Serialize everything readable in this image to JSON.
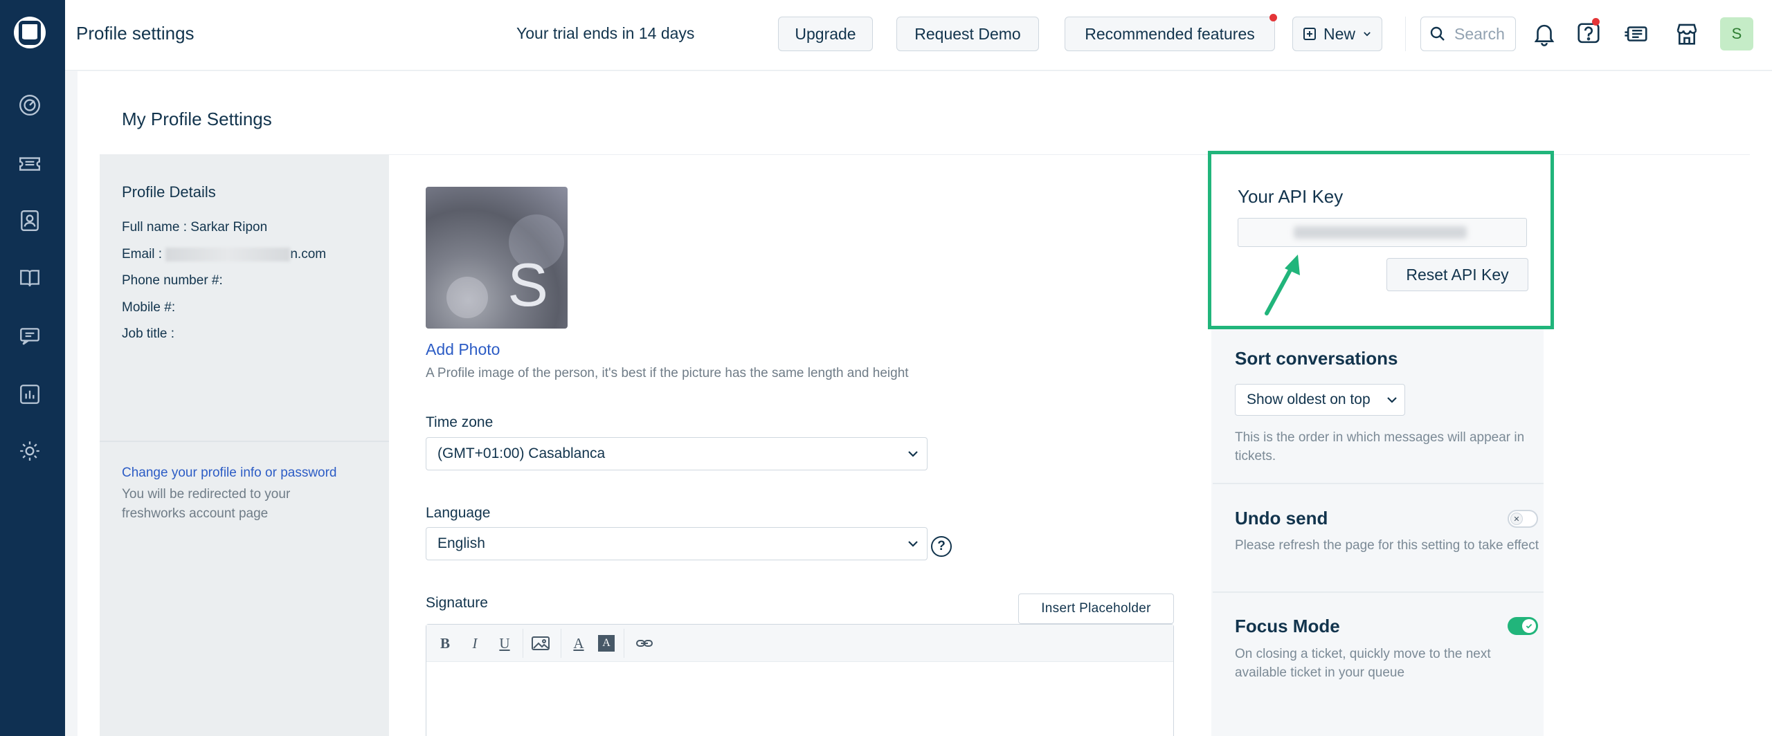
{
  "header": {
    "title": "Profile settings",
    "trial_text": "Your trial ends in 14 days",
    "upgrade_label": "Upgrade",
    "request_demo_label": "Request Demo",
    "recommended_label": "Recommended features",
    "new_label": "New",
    "search_placeholder": "Search",
    "avatar_initial": "S"
  },
  "sidebar": {
    "items": [
      "dashboard-icon",
      "tickets-icon",
      "contacts-icon",
      "solutions-icon",
      "forums-icon",
      "reports-icon",
      "admin-icon"
    ]
  },
  "main": {
    "section_title": "My Profile Settings"
  },
  "profile_details": {
    "title": "Profile Details",
    "full_name_label": "Full name :",
    "full_name": "Sarkar Ripon",
    "email_label": "Email :",
    "email_suffix": "n.com",
    "phone_label": "Phone number #:",
    "mobile_label": "Mobile #:",
    "job_title_label": "Job title :",
    "change_link": "Change your profile info or password",
    "redirect_note": "You will be redirected to your freshworks account page"
  },
  "form": {
    "photo_initial": "S",
    "add_photo": "Add Photo",
    "photo_help": "A Profile image of the person, it's best if the picture has the same length and height",
    "timezone_label": "Time zone",
    "timezone_value": "(GMT+01:00) Casablanca",
    "language_label": "Language",
    "language_value": "English",
    "signature_label": "Signature",
    "insert_placeholder": "Insert Placeholder",
    "toolbar": {
      "bold": "B",
      "italic": "I",
      "underline": "U",
      "font_color": "A",
      "bg_color": "A"
    }
  },
  "api_key": {
    "title": "Your API Key",
    "reset_label": "Reset API Key"
  },
  "settings": {
    "sort_title": "Sort conversations",
    "sort_value": "Show oldest on top",
    "sort_note": "This is the order in which messages will appear in tickets.",
    "undo_title": "Undo send",
    "undo_note": "Please refresh the page for this setting to take effect",
    "undo_enabled": false,
    "focus_title": "Focus Mode",
    "focus_note": "On closing a ticket, quickly move to the next available ticket in your queue",
    "focus_enabled": true
  },
  "colors": {
    "sidebar": "#0f3052",
    "highlight": "#21b57b",
    "link": "#2c5cc5"
  }
}
